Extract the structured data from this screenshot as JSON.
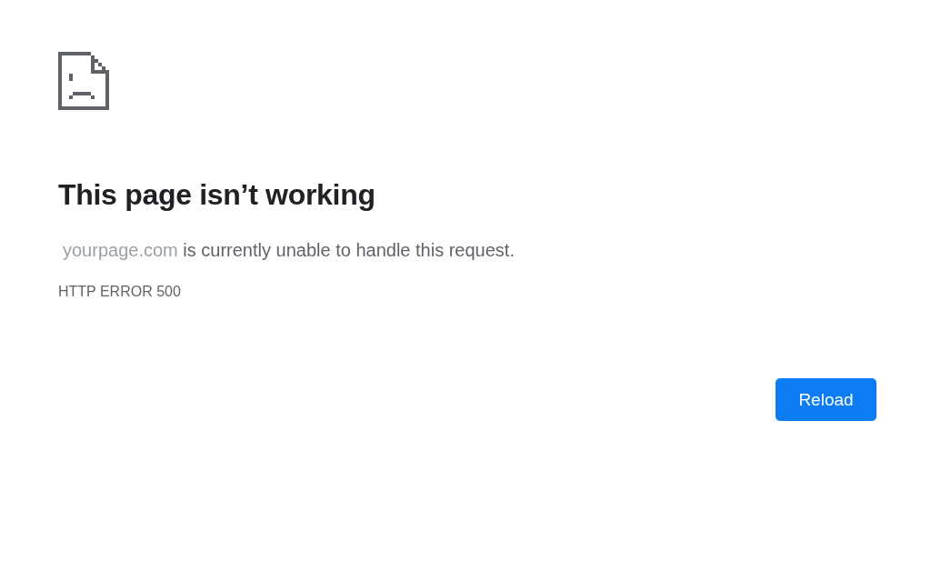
{
  "title": "This page isn’t working",
  "message": {
    "host": "yourpage.com",
    "text": " is currently unable to handle this request."
  },
  "error_code": "HTTP ERROR 500",
  "buttons": [
    "Reload"
  ]
}
